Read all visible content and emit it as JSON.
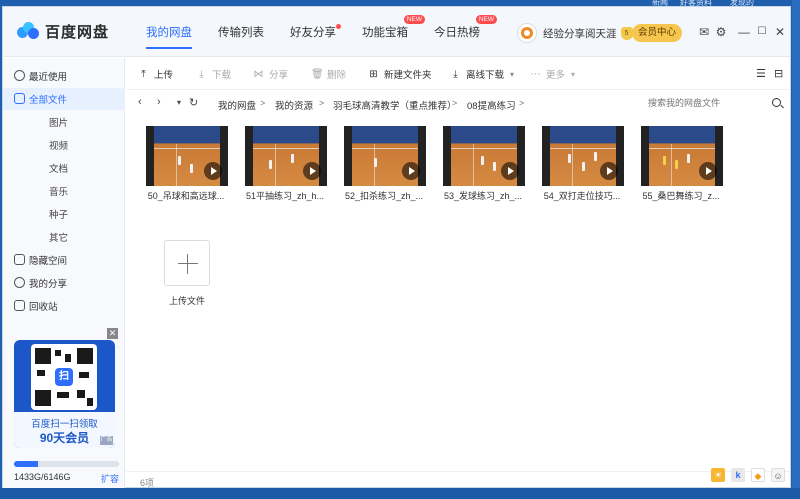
{
  "app": {
    "title": "百度网盘"
  },
  "desktop": {
    "top_left_text": "新闻",
    "top_right_text": "好客资料",
    "top_right_text2": "发现的"
  },
  "nav": {
    "tabs": [
      {
        "label": "我的网盘"
      },
      {
        "label": "传输列表"
      },
      {
        "label": "好友分享"
      },
      {
        "label": "功能宝箱",
        "badge": "NEW"
      },
      {
        "label": "今日热榜",
        "badge": "NEW"
      }
    ]
  },
  "user": {
    "name": "经验分享阅天涯",
    "level": "5",
    "vip_button": "会员中心"
  },
  "sidebar": {
    "items": [
      {
        "label": "最近使用"
      },
      {
        "label": "全部文件"
      },
      {
        "label": "图片"
      },
      {
        "label": "视频"
      },
      {
        "label": "文档"
      },
      {
        "label": "音乐"
      },
      {
        "label": "种子"
      },
      {
        "label": "其它"
      },
      {
        "label": "隐藏空间"
      },
      {
        "label": "我的分享"
      },
      {
        "label": "回收站"
      }
    ],
    "promo": {
      "line1": "百度扫一扫领取",
      "line2": "90天会员",
      "tag": "广告",
      "qr_label": "扫"
    },
    "storage": {
      "used": "1433G/6146G",
      "expand": "扩容",
      "used_fraction": 0.233
    }
  },
  "toolbar": {
    "upload": "上传",
    "download": "下载",
    "share": "分享",
    "delete": "删除",
    "new_folder": "新建文件夹",
    "offline": "离线下载",
    "more": "更多"
  },
  "breadcrumb": {
    "items": [
      "我的网盘",
      "我的资源",
      "羽毛球高清教学（重点推荐）",
      "08提高练习"
    ],
    "search_placeholder": "搜索我的网盘文件"
  },
  "files": [
    {
      "name": "50_吊球和高远球..."
    },
    {
      "name": "51平抽练习_zh_h..."
    },
    {
      "name": "52_扣杀练习_zh_..."
    },
    {
      "name": "53_发球练习_zh_..."
    },
    {
      "name": "54_双打走位技巧..."
    },
    {
      "name": "55_桑巴舞练习_z..."
    }
  ],
  "upload_tile": {
    "label": "上传文件"
  },
  "status": {
    "count": "6项"
  },
  "colors": {
    "accent": "#2f6fff",
    "vip": "#f7c64f"
  }
}
